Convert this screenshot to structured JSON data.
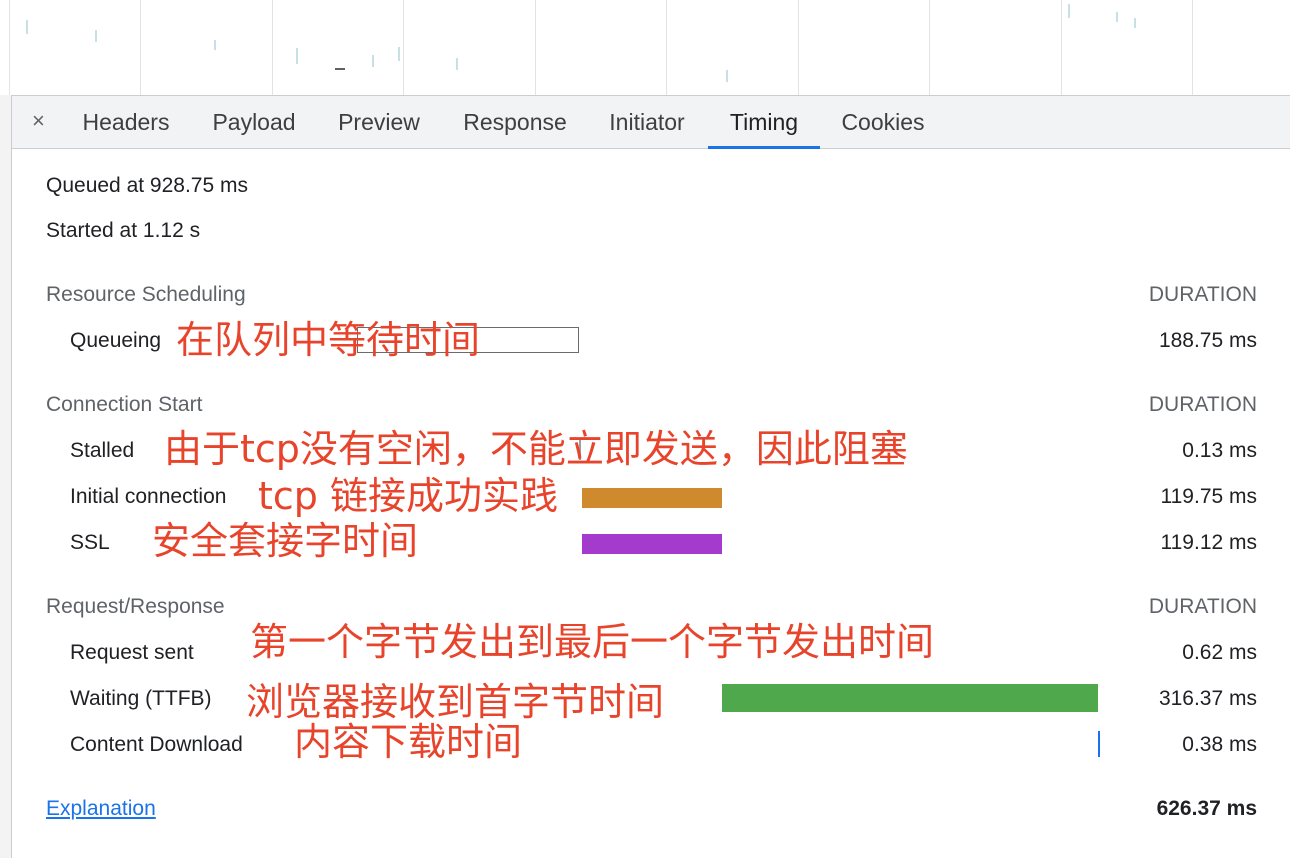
{
  "tabs": {
    "close": "×",
    "items": [
      {
        "label": "Headers"
      },
      {
        "label": "Payload"
      },
      {
        "label": "Preview"
      },
      {
        "label": "Response"
      },
      {
        "label": "Initiator"
      },
      {
        "label": "Timing"
      },
      {
        "label": "Cookies"
      }
    ],
    "active": "Timing",
    "accent_color": "#1a73e8"
  },
  "timing": {
    "queued": "Queued at 928.75 ms",
    "started": "Started at 1.12 s",
    "duration_header": "DURATION",
    "sections": [
      {
        "title": "Resource Scheduling",
        "rows": [
          {
            "label": "Queueing",
            "duration": "188.75 ms"
          }
        ]
      },
      {
        "title": "Connection Start",
        "rows": [
          {
            "label": "Stalled",
            "duration": "0.13 ms"
          },
          {
            "label": "Initial connection",
            "duration": "119.75 ms"
          },
          {
            "label": "SSL",
            "duration": "119.12 ms"
          }
        ]
      },
      {
        "title": "Request/Response",
        "rows": [
          {
            "label": "Request sent",
            "duration": "0.62 ms"
          },
          {
            "label": "Waiting (TTFB)",
            "duration": "316.37 ms"
          },
          {
            "label": "Content Download",
            "duration": "0.38 ms"
          }
        ]
      }
    ],
    "explanation_link": "Explanation",
    "total": "626.37 ms",
    "bar_colors": {
      "queueing": "#ffffff",
      "initial_connection": "#d08a2e",
      "ssl": "#a53bcc",
      "waiting": "#4fa84c",
      "content_download": "#1a73e8"
    }
  },
  "annotations": {
    "queueing": "在队列中等待时间",
    "stalled": "由于tcp没有空闲，不能立即发送，因此阻塞",
    "initial_connection": "tcp 链接成功实践",
    "ssl": "安全套接字时间",
    "request_sent": "第一个字节发出到最后一个字节发出时间",
    "waiting": "浏览器接收到首字节时间",
    "content_download": "内容下载时间",
    "color": "#e8442b"
  }
}
